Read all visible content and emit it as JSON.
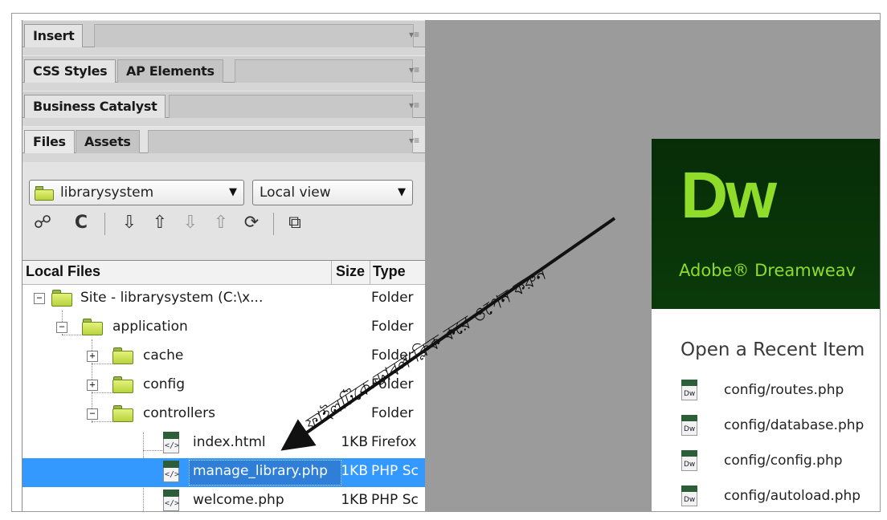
{
  "panels": {
    "insert": {
      "label": "Insert"
    },
    "css": {
      "tabs": [
        "CSS Styles",
        "AP Elements"
      ]
    },
    "business": {
      "label": "Business Catalyst"
    },
    "files": {
      "tabs": [
        "Files",
        "Assets"
      ]
    },
    "menu_glyph": "▾≡"
  },
  "files_panel": {
    "site_select": "librarysystem",
    "view_select": "Local view",
    "toolbar_icons": [
      "connect-icon",
      "refresh-icon",
      "get-icon",
      "put-icon",
      "check-out-icon",
      "check-in-icon",
      "synchronize-icon",
      "expand-icon"
    ],
    "columns": {
      "name": "Local Files",
      "size": "Size",
      "type": "Type"
    },
    "rows": [
      {
        "name": "Site - librarysystem (C:\\x...",
        "size": "",
        "type": "Folder",
        "kind": "folder",
        "toggle": "⊟"
      },
      {
        "name": "application",
        "size": "",
        "type": "Folder",
        "kind": "folder",
        "toggle": "⊟"
      },
      {
        "name": "cache",
        "size": "",
        "type": "Folder",
        "kind": "folder",
        "toggle": "+"
      },
      {
        "name": "config",
        "size": "",
        "type": "Folder",
        "kind": "folder",
        "toggle": "+"
      },
      {
        "name": "controllers",
        "size": "",
        "type": "Folder",
        "kind": "folder",
        "toggle": "−"
      },
      {
        "name": "index.html",
        "size": "1KB",
        "type": "Firefox",
        "kind": "file"
      },
      {
        "name": "manage_library.php",
        "size": "1KB",
        "type": "PHP Sc",
        "kind": "file",
        "selected": true
      },
      {
        "name": "welcome.php",
        "size": "1KB",
        "type": "PHP Sc",
        "kind": "file"
      }
    ]
  },
  "annotation": {
    "text": "ফাইলটিকে ডাবল ক্লিক করে ওপেন করুন"
  },
  "dreamweaver": {
    "logo": "Dw",
    "product": "Adobe® Dreamweav",
    "recent_title": "Open a Recent Item",
    "file_icon_label": "Dw",
    "recent_items": [
      "config/routes.php",
      "config/database.php",
      "config/config.php",
      "config/autoload.php"
    ]
  },
  "colors": {
    "selection": "#3399ff",
    "dw_green": "#8fdc2a",
    "dw_dark": "#072d07",
    "panel_gray": "#d6d6d6",
    "workspace_gray": "#9b9b9b"
  }
}
